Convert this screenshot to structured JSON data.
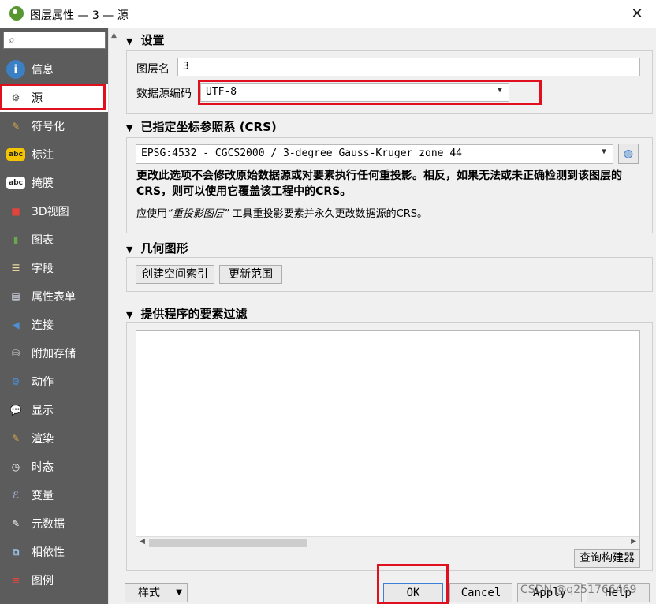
{
  "window": {
    "title": "图层属性 — 3 — 源",
    "close_glyph": "✕"
  },
  "sidebar": {
    "search_placeholder": "",
    "items": [
      {
        "label": "信息",
        "icon": "info-icon",
        "glyph": "i",
        "color": "#3b7fc4"
      },
      {
        "label": "源",
        "icon": "source-wrench-icon",
        "glyph": "⚙",
        "color": "#ffffff"
      },
      {
        "label": "符号化",
        "icon": "symbology-brush-icon",
        "glyph": "✎",
        "color": "#d7a84a"
      },
      {
        "label": "标注",
        "icon": "labels-abc-icon",
        "glyph": "abc",
        "color": "#f5c400"
      },
      {
        "label": "掩膜",
        "icon": "mask-abc-icon",
        "glyph": "abc",
        "color": "#ffffff"
      },
      {
        "label": "3D视图",
        "icon": "3d-cube-icon",
        "glyph": "■",
        "color": "#e8433a"
      },
      {
        "label": "图表",
        "icon": "diagram-chart-icon",
        "glyph": "▮",
        "color": "#6aa84f"
      },
      {
        "label": "字段",
        "icon": "fields-table-icon",
        "glyph": "☰",
        "color": "#e8d9a0"
      },
      {
        "label": "属性表单",
        "icon": "attribute-form-icon",
        "glyph": "▤",
        "color": "#dce3ee"
      },
      {
        "label": "连接",
        "icon": "joins-icon",
        "glyph": "◀",
        "color": "#4f8fd6"
      },
      {
        "label": "附加存储",
        "icon": "auxiliary-storage-icon",
        "glyph": "⛁",
        "color": "#cfcfcf"
      },
      {
        "label": "动作",
        "icon": "actions-gear-icon",
        "glyph": "⚙",
        "color": "#4a90d9"
      },
      {
        "label": "显示",
        "icon": "display-speech-icon",
        "glyph": "💬",
        "color": "#f2c94c"
      },
      {
        "label": "渲染",
        "icon": "rendering-brush-icon",
        "glyph": "✎",
        "color": "#d7a84a"
      },
      {
        "label": "时态",
        "icon": "temporal-clock-icon",
        "glyph": "◷",
        "color": "#ffffff"
      },
      {
        "label": "变量",
        "icon": "variables-icon",
        "glyph": "ℰ",
        "color": "#9aa3c8"
      },
      {
        "label": "元数据",
        "icon": "metadata-icon",
        "glyph": "✎",
        "color": "#ffffff"
      },
      {
        "label": "相依性",
        "icon": "dependencies-icon",
        "glyph": "⧉",
        "color": "#9bc4e8"
      },
      {
        "label": "图例",
        "icon": "legend-icon",
        "glyph": "≡",
        "color": "#e8433a"
      }
    ]
  },
  "settings": {
    "header": "设置",
    "layer_name_label": "图层名",
    "layer_name_value": "3",
    "encoding_label": "数据源编码",
    "encoding_value": "UTF-8"
  },
  "crs": {
    "header": "已指定坐标参照系 (CRS)",
    "value": "EPSG:4532 - CGCS2000 / 3-degree Gauss-Kruger zone 44",
    "warning": "更改此选项不会修改原始数据源或对要素执行任何重投影。相反，如果无法或未正确检测到该图层的CRS，则可以使用它覆盖该工程中的CRS。",
    "hint_prefix": "应使用",
    "hint_tool": "“重投影图层”",
    "hint_suffix": "工具重投影要素并永久更改数据源的CRS。"
  },
  "geometry": {
    "header": "几何图形",
    "create_index_label": "创建空间索引",
    "update_extent_label": "更新范围"
  },
  "filter": {
    "header": "提供程序的要素过滤",
    "query_builder_label": "查询构建器"
  },
  "footer": {
    "style_label": "样式",
    "ok_label": "OK",
    "cancel_label": "Cancel",
    "apply_label": "Apply",
    "help_label": "Help",
    "watermark": "CSDN @q251766469"
  },
  "colors": {
    "highlight_red": "#e0101e",
    "sidebar_bg": "#5c5c5c"
  }
}
